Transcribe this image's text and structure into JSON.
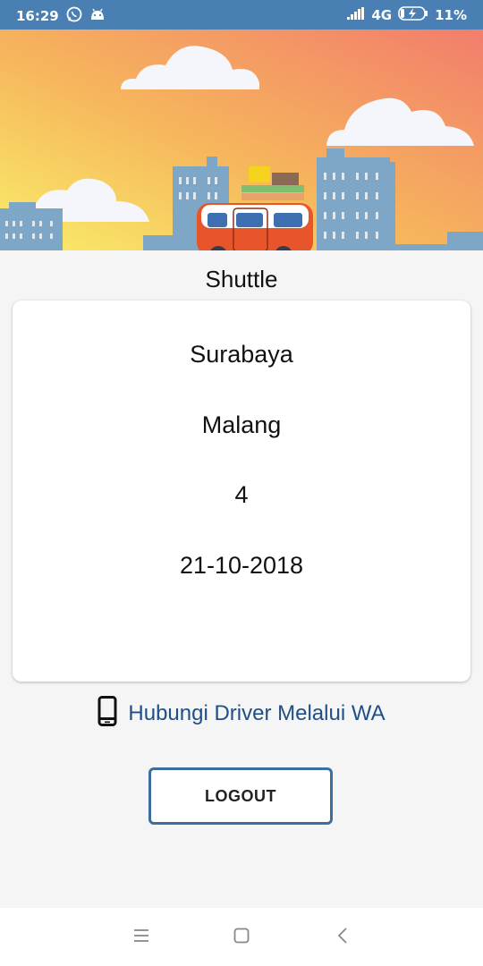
{
  "status_bar": {
    "time": "16:29",
    "network": "4G",
    "battery": "11%",
    "icons": [
      "whatsapp-icon",
      "android-icon",
      "signal-icon",
      "battery-charging-icon"
    ]
  },
  "app": {
    "title": "Shuttle"
  },
  "trip": {
    "origin": "Surabaya",
    "destination": "Malang",
    "passengers": "4",
    "date": "21-10-2018"
  },
  "contact": {
    "label": "Hubungi Driver Melalui WA",
    "icon": "phone-icon"
  },
  "actions": {
    "logout_label": "LOGOUT"
  },
  "nav_bar": {
    "icons": [
      "menu-icon",
      "home-icon",
      "back-icon"
    ]
  },
  "colors": {
    "status_bar": "#4a7fb3",
    "link": "#1f4f87",
    "button_border": "#3d6e9c",
    "van_body": "#e9552b"
  }
}
